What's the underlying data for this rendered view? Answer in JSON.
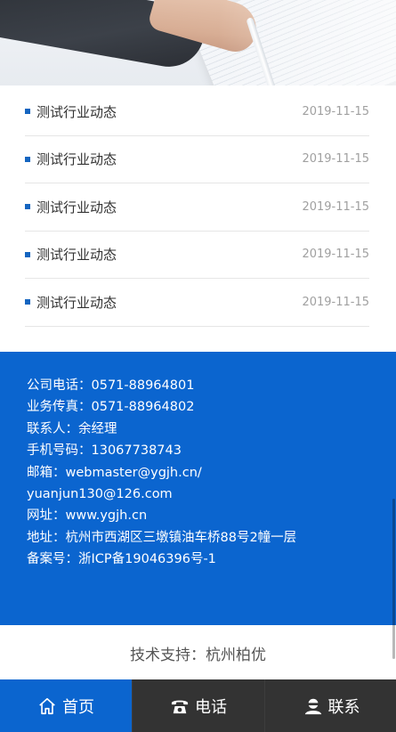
{
  "hero": {
    "icon": "banner-image-hand-on-papers"
  },
  "news": {
    "items": [
      {
        "title": "测试行业动态",
        "date": "2019-11-15"
      },
      {
        "title": "测试行业动态",
        "date": "2019-11-15"
      },
      {
        "title": "测试行业动态",
        "date": "2019-11-15"
      },
      {
        "title": "测试行业动态",
        "date": "2019-11-15"
      },
      {
        "title": "测试行业动态",
        "date": "2019-11-15"
      }
    ]
  },
  "contact": {
    "lines": [
      "公司电话：0571-88964801",
      "业务传真：0571-88964802",
      "联系人：余经理",
      "手机号码：13067738743",
      "邮箱：webmaster@ygjh.cn/",
      "yuanjun130@126.com",
      "网址：www.ygjh.cn",
      "地址：杭州市西湖区三墩镇油车桥88号2幢一层",
      "备案号：浙ICP备19046396号-1"
    ]
  },
  "footer": {
    "support": "技术支持：杭州柏优"
  },
  "bottom_nav": {
    "home": {
      "label": "首页",
      "icon": "home-icon"
    },
    "phone": {
      "label": "电话",
      "icon": "phone-icon"
    },
    "contact": {
      "label": "联系",
      "icon": "user-icon"
    }
  },
  "colors": {
    "primary": "#0b65cf",
    "dark": "#333333",
    "bullet": "#1565c0"
  }
}
